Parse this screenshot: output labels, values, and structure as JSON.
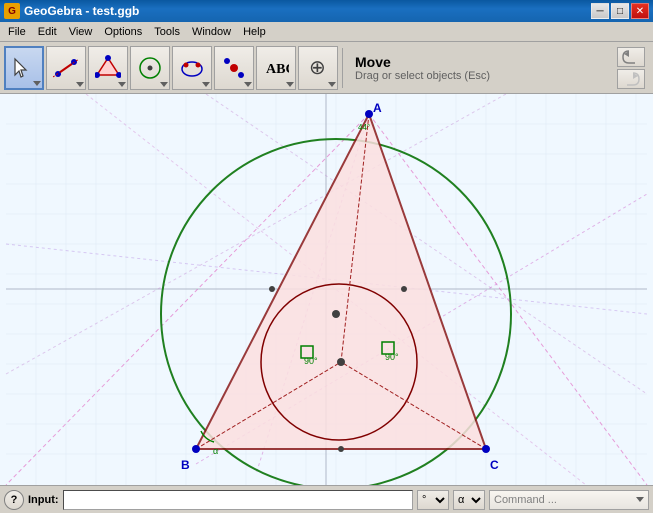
{
  "titlebar": {
    "title": "GeoGebra - test.ggb",
    "icon": "G",
    "btn_minimize": "─",
    "btn_maximize": "□",
    "btn_close": "✕"
  },
  "menubar": {
    "items": [
      "File",
      "Edit",
      "View",
      "Options",
      "Tools",
      "Window",
      "Help"
    ]
  },
  "toolbar": {
    "tools": [
      {
        "id": "move",
        "active": true
      },
      {
        "id": "line"
      },
      {
        "id": "polygon"
      },
      {
        "id": "circle"
      },
      {
        "id": "conic"
      },
      {
        "id": "point"
      },
      {
        "id": "text"
      },
      {
        "id": "transform"
      }
    ],
    "active_tool_name": "Move",
    "active_tool_desc": "Drag or select objects (Esc)"
  },
  "bottombar": {
    "help_label": "?",
    "input_label": "Input:",
    "input_placeholder": "",
    "degree_symbol": "°",
    "alpha_symbol": "α",
    "command_placeholder": "Command ..."
  },
  "canvas": {
    "bg": "#f0f8ff",
    "grid_color": "#e0e8f0"
  }
}
